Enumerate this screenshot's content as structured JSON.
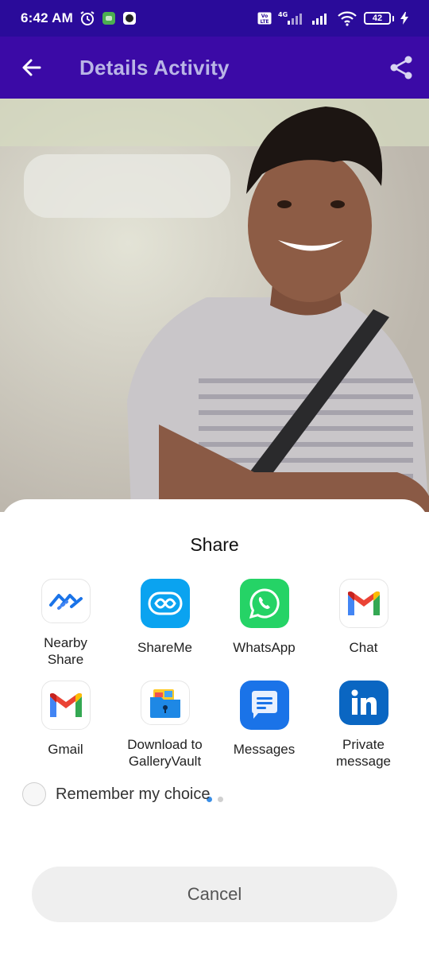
{
  "status_bar": {
    "time": "6:42 AM",
    "network_label": "4G",
    "volte_label": "Vo LTE",
    "battery_level": "42"
  },
  "app_bar": {
    "title": "Details Activity",
    "back_icon": "arrow-left-icon",
    "share_icon": "share-icon"
  },
  "sheet": {
    "title": "Share",
    "apps": [
      {
        "label": "Nearby\nShare",
        "icon": "nearby-share-icon"
      },
      {
        "label": "ShareMe",
        "icon": "shareme-icon"
      },
      {
        "label": "WhatsApp",
        "icon": "whatsapp-icon"
      },
      {
        "label": "Chat",
        "icon": "gmail-icon"
      },
      {
        "label": "Gmail",
        "icon": "gmail-icon"
      },
      {
        "label": "Download to\nGalleryVault",
        "icon": "galleryvault-icon"
      },
      {
        "label": "Messages",
        "icon": "messages-icon"
      },
      {
        "label": "Private\nmessage",
        "icon": "linkedin-icon"
      }
    ],
    "page_count": 2,
    "current_page": 1,
    "remember_label": "Remember my choice",
    "cancel_label": "Cancel"
  },
  "colors": {
    "status_bar": "#2a0b9a",
    "app_bar": "#3b0aa6",
    "app_title": "#b9b5e6"
  }
}
